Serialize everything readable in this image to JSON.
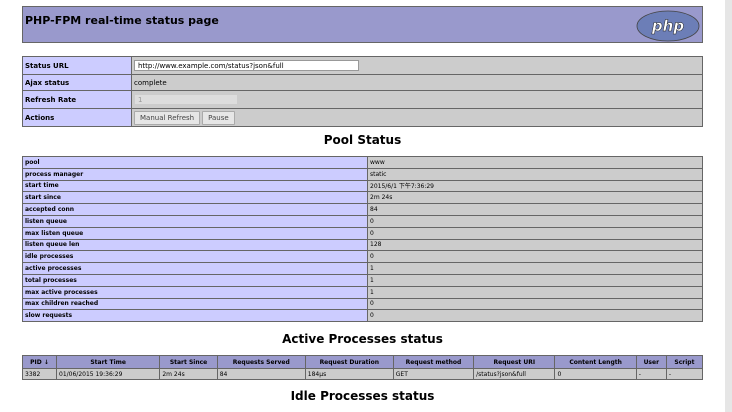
{
  "header": {
    "title": "PHP-FPM real-time status page",
    "logo_text": "php"
  },
  "form": {
    "status_url_label": "Status URL",
    "status_url_value": "http://www.example.com/status?json&full",
    "ajax_status_label": "Ajax status",
    "ajax_status_value": "complete",
    "refresh_rate_label": "Refresh Rate",
    "refresh_rate_value": "1",
    "actions_label": "Actions",
    "manual_refresh_label": "Manual Refresh",
    "pause_label": "Pause"
  },
  "pool_status": {
    "title": "Pool Status",
    "rows": [
      {
        "key": "pool",
        "value": "www"
      },
      {
        "key": "process manager",
        "value": "static"
      },
      {
        "key": "start time",
        "value": "2015/6/1 下午7:36:29"
      },
      {
        "key": "start since",
        "value": "2m 24s"
      },
      {
        "key": "accepted conn",
        "value": "84"
      },
      {
        "key": "listen queue",
        "value": "0"
      },
      {
        "key": "max listen queue",
        "value": "0"
      },
      {
        "key": "listen queue len",
        "value": "128"
      },
      {
        "key": "idle processes",
        "value": "0"
      },
      {
        "key": "active processes",
        "value": "1"
      },
      {
        "key": "total processes",
        "value": "1"
      },
      {
        "key": "max active processes",
        "value": "1"
      },
      {
        "key": "max children reached",
        "value": "0"
      },
      {
        "key": "slow requests",
        "value": "0"
      }
    ]
  },
  "active_processes": {
    "title": "Active Processes status",
    "headers": [
      "PID ↓",
      "Start Time",
      "Start Since",
      "Requests Served",
      "Request Duration",
      "Request method",
      "Request URI",
      "Content Length",
      "User",
      "Script"
    ],
    "rows": [
      [
        "3382",
        "01/06/2015 19:36:29",
        "2m 24s",
        "84",
        "184µs",
        "GET",
        "/status?json&full",
        "0",
        "-",
        "-"
      ]
    ]
  },
  "idle_processes": {
    "title": "Idle Processes status"
  },
  "colors": {
    "header_bg": "#9999cc",
    "key_bg": "#ccccff",
    "value_bg": "#cccccc"
  }
}
